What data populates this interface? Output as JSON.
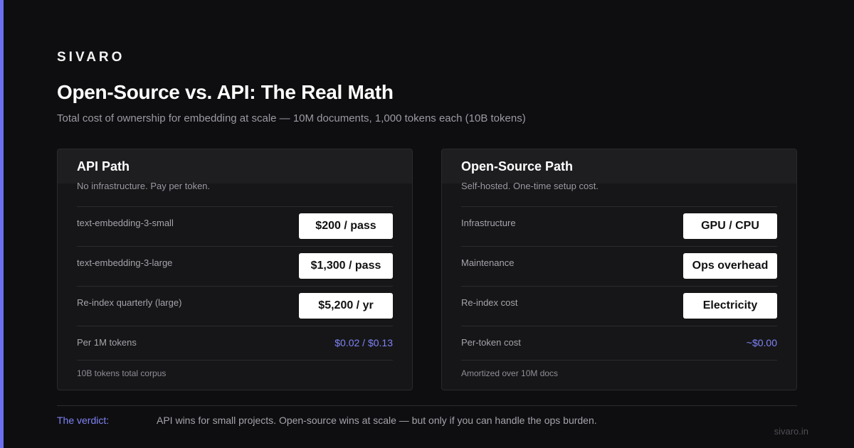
{
  "brand": "SIVARO",
  "title": "Open-Source vs. API: The Real Math",
  "subtitle": "Total cost of ownership for embedding at scale — 10M documents, 1,000 tokens each (10B tokens)",
  "colors": {
    "accent": "#6b6ff0",
    "background": "#0e0e10",
    "card": "#161618",
    "highlight_text": "#7f83f5"
  },
  "api": {
    "title": "API Path",
    "description": "No infrastructure. Pay per token.",
    "rows": [
      {
        "label": "text-embedding-3-small",
        "value": "$200 / pass"
      },
      {
        "label": "text-embedding-3-large",
        "value": "$1,300 / pass"
      },
      {
        "label": "Re-index quarterly (large)",
        "value": "$5,200 / yr"
      }
    ],
    "rate": {
      "label": "Per 1M tokens",
      "value": "$0.02 / $0.13"
    },
    "note": "10B tokens total corpus"
  },
  "open_source": {
    "title": "Open-Source Path",
    "description": "Self-hosted. One-time setup cost.",
    "rows": [
      {
        "label": "Infrastructure",
        "value": "GPU / CPU"
      },
      {
        "label": "Maintenance",
        "value": "Ops overhead"
      },
      {
        "label": "Re-index cost",
        "value": "Electricity"
      }
    ],
    "rate": {
      "label": "Per-token cost",
      "value": "~$0.00"
    },
    "note": "Amortized over 10M docs"
  },
  "verdict": {
    "label": "The verdict:",
    "text": "API wins for small projects. Open-source wins at scale — but only if you can handle the ops burden."
  },
  "site": "sivaro.in"
}
